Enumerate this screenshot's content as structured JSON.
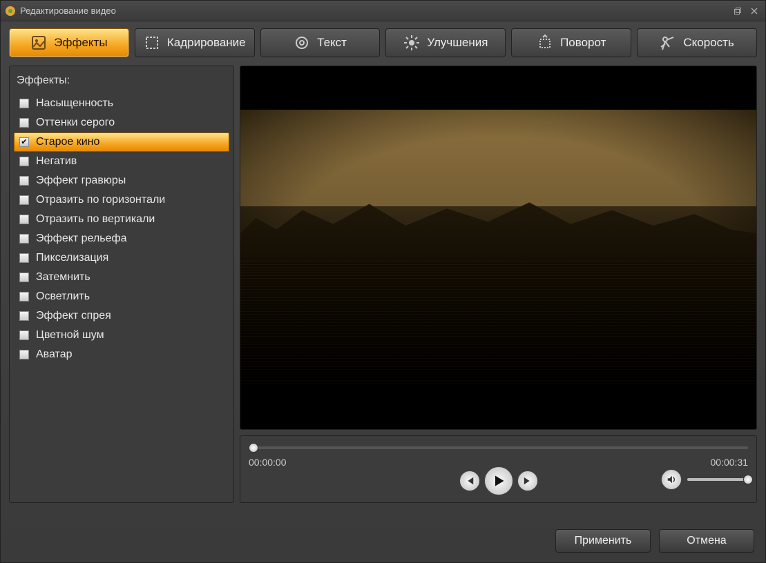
{
  "window": {
    "title": "Редактирование видео"
  },
  "tabs": [
    {
      "label": "Эффекты"
    },
    {
      "label": "Кадрирование"
    },
    {
      "label": "Текст"
    },
    {
      "label": "Улучшения"
    },
    {
      "label": "Поворот"
    },
    {
      "label": "Скорость"
    }
  ],
  "panel": {
    "title": "Эффекты:"
  },
  "effects": [
    {
      "label": "Насыщенность",
      "checked": false,
      "selected": false
    },
    {
      "label": "Оттенки серого",
      "checked": false,
      "selected": false
    },
    {
      "label": "Старое кино",
      "checked": true,
      "selected": true
    },
    {
      "label": "Негатив",
      "checked": false,
      "selected": false
    },
    {
      "label": "Эффект гравюры",
      "checked": false,
      "selected": false
    },
    {
      "label": "Отразить по горизонтали",
      "checked": false,
      "selected": false
    },
    {
      "label": "Отразить по вертикали",
      "checked": false,
      "selected": false
    },
    {
      "label": "Эффект рельефа",
      "checked": false,
      "selected": false
    },
    {
      "label": "Пикселизация",
      "checked": false,
      "selected": false
    },
    {
      "label": "Затемнить",
      "checked": false,
      "selected": false
    },
    {
      "label": "Осветлить",
      "checked": false,
      "selected": false
    },
    {
      "label": "Эффект спрея",
      "checked": false,
      "selected": false
    },
    {
      "label": "Цветной шум",
      "checked": false,
      "selected": false
    },
    {
      "label": "Аватар",
      "checked": false,
      "selected": false
    }
  ],
  "player": {
    "current": "00:00:00",
    "total": "00:00:31"
  },
  "footer": {
    "apply": "Применить",
    "cancel": "Отмена"
  }
}
